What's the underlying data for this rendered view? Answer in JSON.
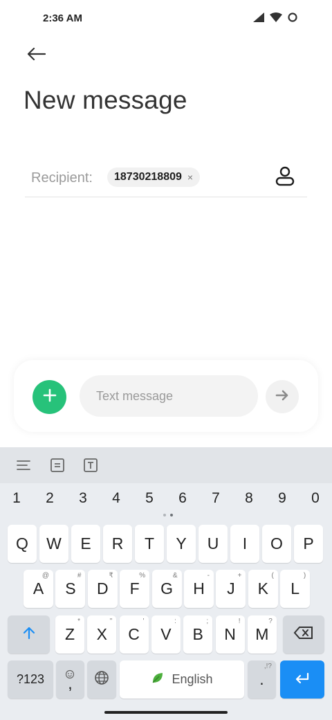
{
  "status_bar": {
    "time": "2:36 AM",
    "icons": [
      "signal-icon",
      "wifi-icon",
      "dnd-icon"
    ]
  },
  "header": {
    "back_icon": "arrow-left-icon",
    "title": "New message"
  },
  "recipient": {
    "label": "Recipient:",
    "chip_value": "18730218809",
    "chip_remove": "×",
    "contact_icon": "contact-person-icon"
  },
  "composer": {
    "add_icon": "plus-icon",
    "placeholder": "Text message",
    "value": "",
    "send_icon": "arrow-right-icon",
    "add_color": "#27c27a"
  },
  "keyboard": {
    "toolbar_icons": [
      "align-left-icon",
      "clipboard-icon",
      "text-format-icon"
    ],
    "number_row": [
      "1",
      "2",
      "3",
      "4",
      "5",
      "6",
      "7",
      "8",
      "9",
      "0"
    ],
    "row1": [
      {
        "key": "Q",
        "hint": ""
      },
      {
        "key": "W",
        "hint": ""
      },
      {
        "key": "E",
        "hint": ""
      },
      {
        "key": "R",
        "hint": ""
      },
      {
        "key": "T",
        "hint": ""
      },
      {
        "key": "Y",
        "hint": ""
      },
      {
        "key": "U",
        "hint": ""
      },
      {
        "key": "I",
        "hint": ""
      },
      {
        "key": "O",
        "hint": ""
      },
      {
        "key": "P",
        "hint": ""
      }
    ],
    "row2": [
      {
        "key": "A",
        "hint": "@"
      },
      {
        "key": "S",
        "hint": "#"
      },
      {
        "key": "D",
        "hint": "₹"
      },
      {
        "key": "F",
        "hint": "%"
      },
      {
        "key": "G",
        "hint": "&"
      },
      {
        "key": "H",
        "hint": "-"
      },
      {
        "key": "J",
        "hint": "+"
      },
      {
        "key": "K",
        "hint": "("
      },
      {
        "key": "L",
        "hint": ")"
      }
    ],
    "row3": [
      {
        "key": "Z",
        "hint": "*"
      },
      {
        "key": "X",
        "hint": "\""
      },
      {
        "key": "C",
        "hint": "'"
      },
      {
        "key": "V",
        "hint": ":"
      },
      {
        "key": "B",
        "hint": ";"
      },
      {
        "key": "N",
        "hint": "!"
      },
      {
        "key": "M",
        "hint": "?"
      }
    ],
    "shift_icon": "shift-arrow-up-icon",
    "backspace_icon": "backspace-icon",
    "symbols_label": "?123",
    "comma_label": ",",
    "emoji_hint_icon": "emoji-icon",
    "globe_icon": "globe-icon",
    "space_label": "English",
    "space_icon": "leaf-icon",
    "period_label": ".",
    "period_hint": ",!?",
    "enter_icon": "enter-arrow-icon",
    "enter_color": "#1a8ef5"
  }
}
